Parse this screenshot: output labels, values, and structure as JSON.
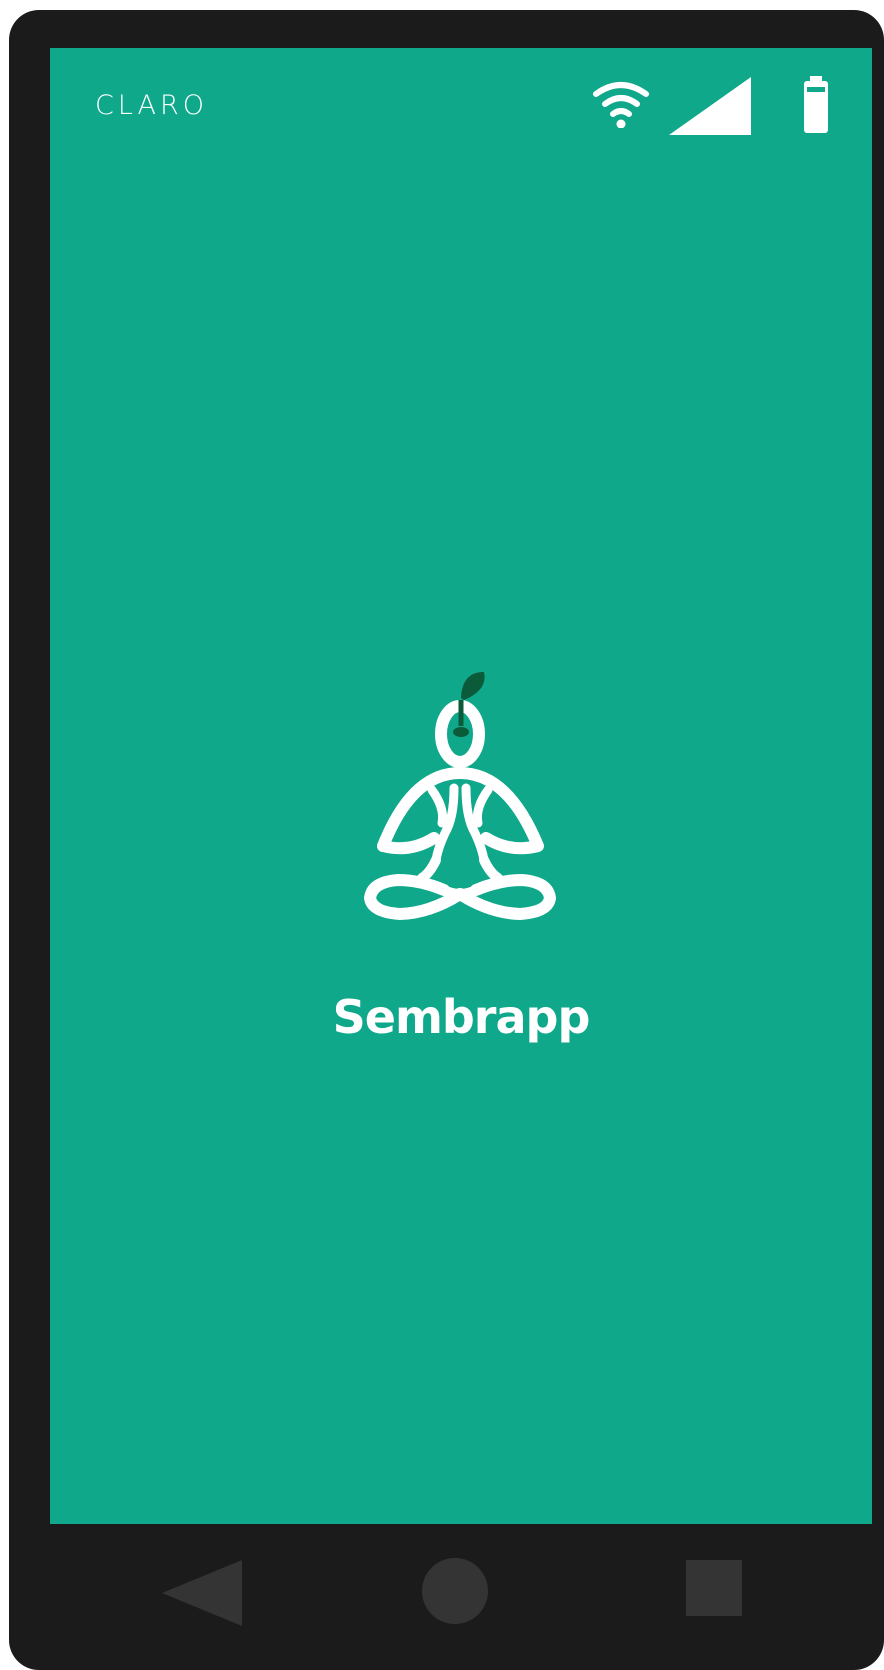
{
  "status_bar": {
    "carrier": "CLARO",
    "icons": [
      "wifi-icon",
      "signal-icon",
      "battery-icon"
    ]
  },
  "splash": {
    "logo_icon": "meditating-sprout-logo-icon",
    "app_name": "Sembrapp"
  },
  "navigation": {
    "buttons": [
      "back-icon",
      "home-icon",
      "recents-icon"
    ]
  },
  "colors": {
    "screen_background": "#0fa88b",
    "device_frame": "#1b1b1b",
    "logo_primary": "#ffffff",
    "leaf_accent": "#0b5a3a",
    "nav_buttons": "#343434"
  }
}
